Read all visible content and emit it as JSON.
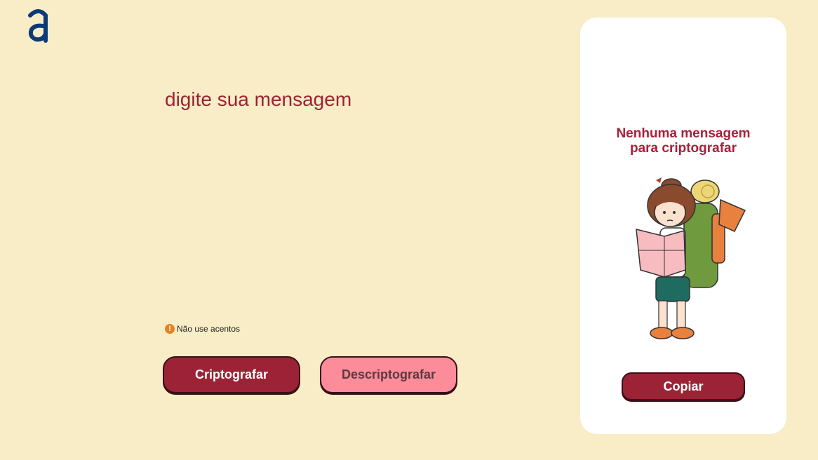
{
  "app": {
    "logo_icon": "alura-a-logo-icon",
    "accent_color": "#9b2335"
  },
  "input": {
    "placeholder": "digite sua mensagem",
    "value": ""
  },
  "hint": {
    "icon": "exclamation-circle-icon",
    "text": "Não use acentos"
  },
  "buttons": {
    "encrypt_label": "Criptografar",
    "decrypt_label": "Descriptografar"
  },
  "output": {
    "empty_title_line1": "Nenhuma mensagem",
    "empty_title_line2": "para criptografar",
    "illustration": "traveler-girl-reading-map-illustration",
    "copy_label": "Copiar"
  }
}
